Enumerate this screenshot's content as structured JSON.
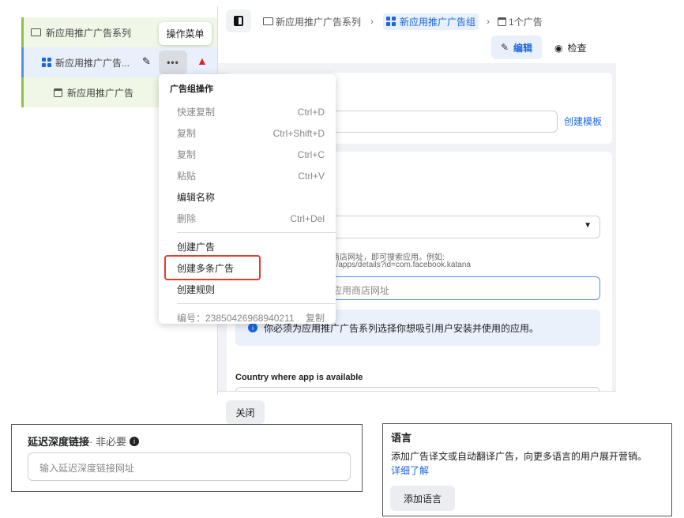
{
  "tree": {
    "campaign": "新应用推广广告系列",
    "adset": "新应用推广广告...",
    "ad": "新应用推广广告",
    "tooltip": "操作菜单"
  },
  "breadcrumb": {
    "campaign": "新应用推广广告系列",
    "adset": "新应用推广广告组",
    "ads": "1个广告"
  },
  "toolbar": {
    "edit": "编辑",
    "review": "检查"
  },
  "menu": {
    "header": "广告组操作",
    "items": [
      {
        "label": "快速复制",
        "shortcut": "Ctrl+D"
      },
      {
        "label": "复制",
        "shortcut": "Ctrl+Shift+D"
      },
      {
        "label": "复制",
        "shortcut": "Ctrl+C"
      },
      {
        "label": "粘贴",
        "shortcut": "Ctrl+V"
      },
      {
        "label": "编辑名称",
        "shortcut": ""
      },
      {
        "label": "删除",
        "shortcut": "Ctrl+Del"
      },
      {
        "label": "创建广告"
      },
      {
        "label": "创建多条广告"
      },
      {
        "label": "创建规则"
      }
    ],
    "id_label": "编号：23850426968940211",
    "copy": "复制"
  },
  "form": {
    "create_template": "创建模板",
    "helper1": "商店网址，即可搜索应用。例如:",
    "helper2": "e/apps/details?id=com.facebook.katana",
    "store_placeholder": "应用商店网址",
    "info": "你必须为应用推广广告系列选择你想吸引用户安装并使用的应用。",
    "country_label": "Country where app is available",
    "close": "关闭"
  },
  "deeplink": {
    "title": "延迟深度链接",
    "optional": " · 非必要",
    "placeholder": "输入延迟深度链接网址"
  },
  "language": {
    "title": "语言",
    "desc": "添加广告译文或自动翻译广告，向更多语言的用户展开营销。",
    "learn_more": "详细了解",
    "add": "添加语言"
  }
}
